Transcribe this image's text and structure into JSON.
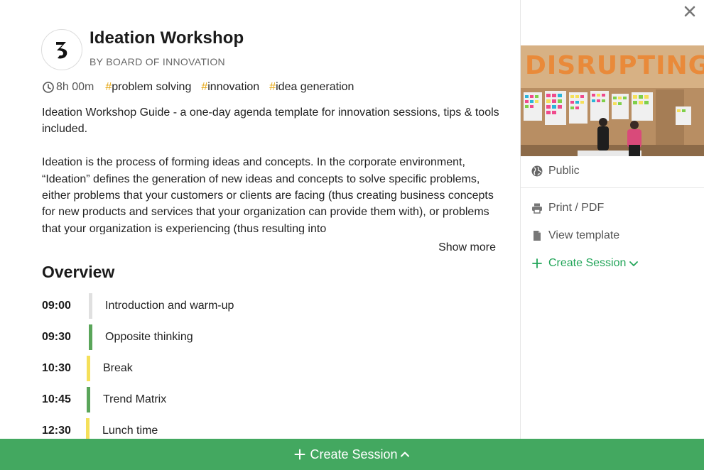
{
  "template": {
    "title": "Ideation Workshop",
    "author": "BY BOARD OF INNOVATION",
    "duration": "8h 00m",
    "tags": [
      "problem solving",
      "innovation",
      "idea generation"
    ],
    "description": [
      "Ideation Workshop Guide - a one-day agenda template for innovation sessions, tips & tools included.",
      "Ideation is the process of forming ideas and concepts. In the corporate environment, “Ideation” defines the generation of new ideas and concepts to solve specific problems, either problems that your customers or clients are facing (thus creating business concepts for new products and services that your organization can provide them with), or problems that your organization is experiencing (thus resulting into"
    ],
    "show_more_label": "Show more"
  },
  "overview": {
    "title": "Overview",
    "items": [
      {
        "time": "09:00",
        "label": "Introduction and warm-up",
        "color": "#e0e0e0"
      },
      {
        "time": "09:30",
        "label": "Opposite thinking",
        "color": "#5aa55a"
      },
      {
        "time": "10:30",
        "label": "Break",
        "color": "#f5e05a"
      },
      {
        "time": "10:45",
        "label": "Trend Matrix",
        "color": "#5aa55a"
      },
      {
        "time": "12:30",
        "label": "Lunch time",
        "color": "#f5e05a"
      }
    ]
  },
  "sidebar": {
    "cover_text": "DISRUPTING",
    "visibility": "Public",
    "print_label": "Print / PDF",
    "view_label": "View template",
    "create_label": "Create Session"
  },
  "footer": {
    "create_label": "Create Session"
  },
  "colors": {
    "accent_green": "#43a860",
    "tag_hash": "#e6a817"
  }
}
